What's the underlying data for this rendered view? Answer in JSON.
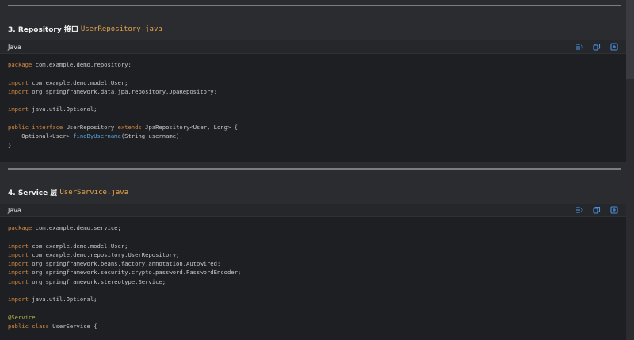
{
  "colors": {
    "page_bg": "#2b2c30",
    "code_bg": "#1e1f23",
    "keyword": "#d48a3f",
    "function": "#5aa4e0",
    "annotation": "#b5b84a",
    "inline_code": "#e4a24c",
    "icon": "#4a90e2"
  },
  "sections": [
    {
      "heading_prefix": "3. Repository 接口",
      "heading_code": "UserRepository.java",
      "language": "Java",
      "lines": [
        [
          {
            "t": "package",
            "c": "kw"
          },
          {
            "t": " com.example.demo.repository;"
          }
        ],
        [],
        [
          {
            "t": "import",
            "c": "kw"
          },
          {
            "t": " com.example.demo.model.User;"
          }
        ],
        [
          {
            "t": "import",
            "c": "kw"
          },
          {
            "t": " org.springframework.data.jpa.repository.JpaRepository;"
          }
        ],
        [],
        [
          {
            "t": "import",
            "c": "kw"
          },
          {
            "t": " java.util.Optional;"
          }
        ],
        [],
        [
          {
            "t": "public",
            "c": "kw"
          },
          {
            "t": " "
          },
          {
            "t": "interface",
            "c": "kw"
          },
          {
            "t": " UserRepository "
          },
          {
            "t": "extends",
            "c": "kw"
          },
          {
            "t": " JpaRepository<User, Long> {"
          }
        ],
        [
          {
            "t": "    Optional<User> "
          },
          {
            "t": "findByUsername",
            "c": "fn"
          },
          {
            "t": "(String username);"
          }
        ],
        [
          {
            "t": "}"
          }
        ]
      ]
    },
    {
      "heading_prefix": "4. Service 层",
      "heading_code": "UserService.java",
      "language": "Java",
      "lines": [
        [
          {
            "t": "package",
            "c": "kw"
          },
          {
            "t": " com.example.demo.service;"
          }
        ],
        [],
        [
          {
            "t": "import",
            "c": "kw"
          },
          {
            "t": " com.example.demo.model.User;"
          }
        ],
        [
          {
            "t": "import",
            "c": "kw"
          },
          {
            "t": " com.example.demo.repository.UserRepository;"
          }
        ],
        [
          {
            "t": "import",
            "c": "kw"
          },
          {
            "t": " org.springframework.beans.factory.annotation.Autowired;"
          }
        ],
        [
          {
            "t": "import",
            "c": "kw"
          },
          {
            "t": " org.springframework.security.crypto.password.PasswordEncoder;"
          }
        ],
        [
          {
            "t": "import",
            "c": "kw"
          },
          {
            "t": " org.springframework.stereotype.Service;"
          }
        ],
        [],
        [
          {
            "t": "import",
            "c": "kw"
          },
          {
            "t": " java.util.Optional;"
          }
        ],
        [],
        [
          {
            "t": "@Service",
            "c": "ann"
          }
        ],
        [
          {
            "t": "public",
            "c": "kw"
          },
          {
            "t": " "
          },
          {
            "t": "class",
            "c": "kw"
          },
          {
            "t": " UserService {"
          }
        ]
      ]
    }
  ]
}
